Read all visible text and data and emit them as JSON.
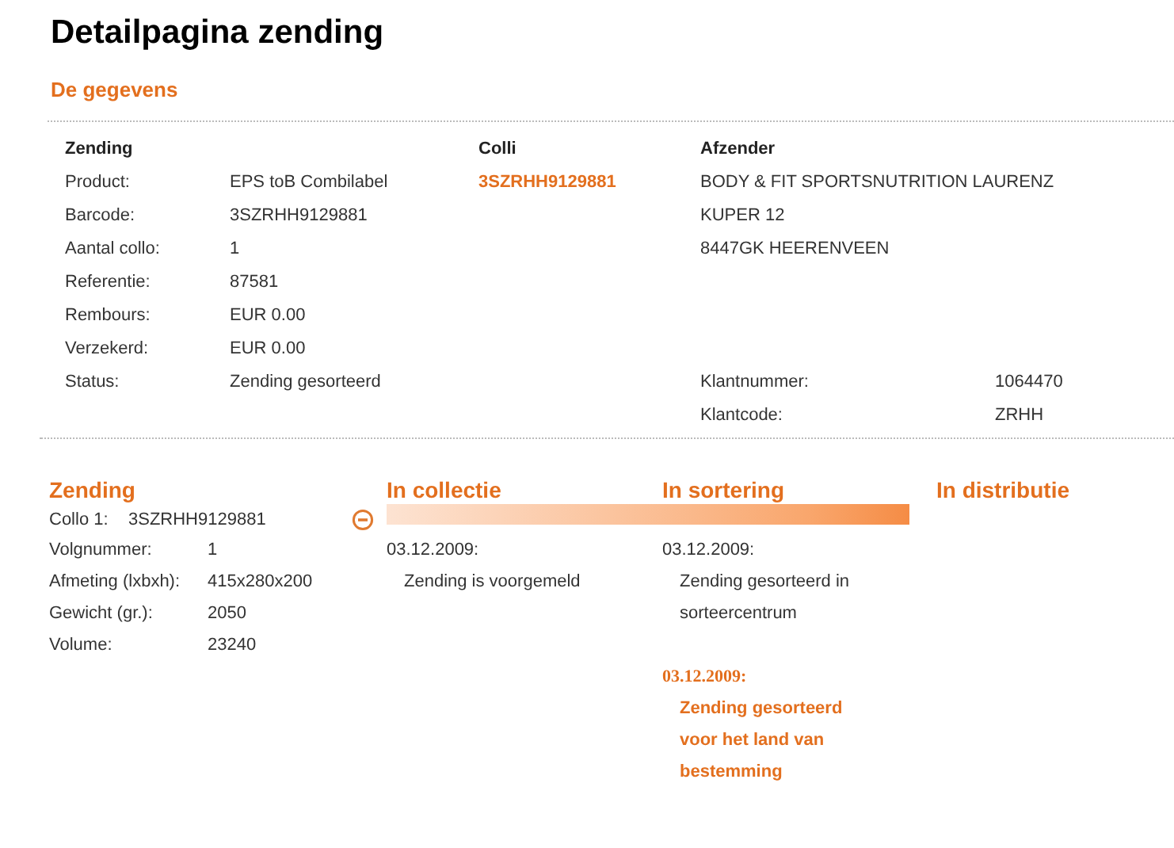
{
  "page_title": "Detailpagina zending",
  "section_title": "De gegevens",
  "details": {
    "zending": {
      "heading": "Zending",
      "fields": [
        {
          "label": "Product:",
          "value": "EPS toB Combilabel"
        },
        {
          "label": "Barcode:",
          "value": "3SZRHH9129881"
        },
        {
          "label": "Aantal collo:",
          "value": "1"
        },
        {
          "label": "Referentie:",
          "value": "87581"
        },
        {
          "label": "Rembours:",
          "value": "EUR 0.00"
        },
        {
          "label": "Verzekerd:",
          "value": "EUR 0.00"
        },
        {
          "label": "Status:",
          "value": "Zending gesorteerd"
        }
      ]
    },
    "colli": {
      "heading": "Colli",
      "items": [
        "3SZRHH9129881"
      ]
    },
    "afzender": {
      "heading": "Afzender",
      "lines": [
        "BODY & FIT SPORTSNUTRITION LAURENZ",
        "KUPER 12",
        "8447GK HEERENVEEN"
      ],
      "fields": [
        {
          "label": "Klantnummer:",
          "value": "1064470"
        },
        {
          "label": "Klantcode:",
          "value": "ZRHH"
        }
      ]
    }
  },
  "tracking": {
    "heading": "Zending",
    "collo": {
      "label": "Collo 1:",
      "value": "3SZRHH9129881",
      "expanded": true
    },
    "fields": [
      {
        "label": "Volgnummer:",
        "value": "1"
      },
      {
        "label": "Afmeting (lxbxh):",
        "value": "415x280x200"
      },
      {
        "label": "Gewicht (gr.):",
        "value": "2050"
      },
      {
        "label": "Volume:",
        "value": "23240"
      }
    ],
    "stages": [
      {
        "title": "In collectie",
        "reached": true,
        "events": [
          {
            "date": "03.12.2009:",
            "text": "Zending is voorgemeld",
            "highlighted": false
          }
        ]
      },
      {
        "title": "In sortering",
        "reached": true,
        "events": [
          {
            "date": "03.12.2009:",
            "text": "Zending gesorteerd in sorteercentrum",
            "highlighted": false
          },
          {
            "date": "03.12.2009:",
            "text": "Zending gesorteerd voor het land van bestemming",
            "highlighted": true
          }
        ]
      },
      {
        "title": "In distributie",
        "reached": false
      }
    ]
  }
}
